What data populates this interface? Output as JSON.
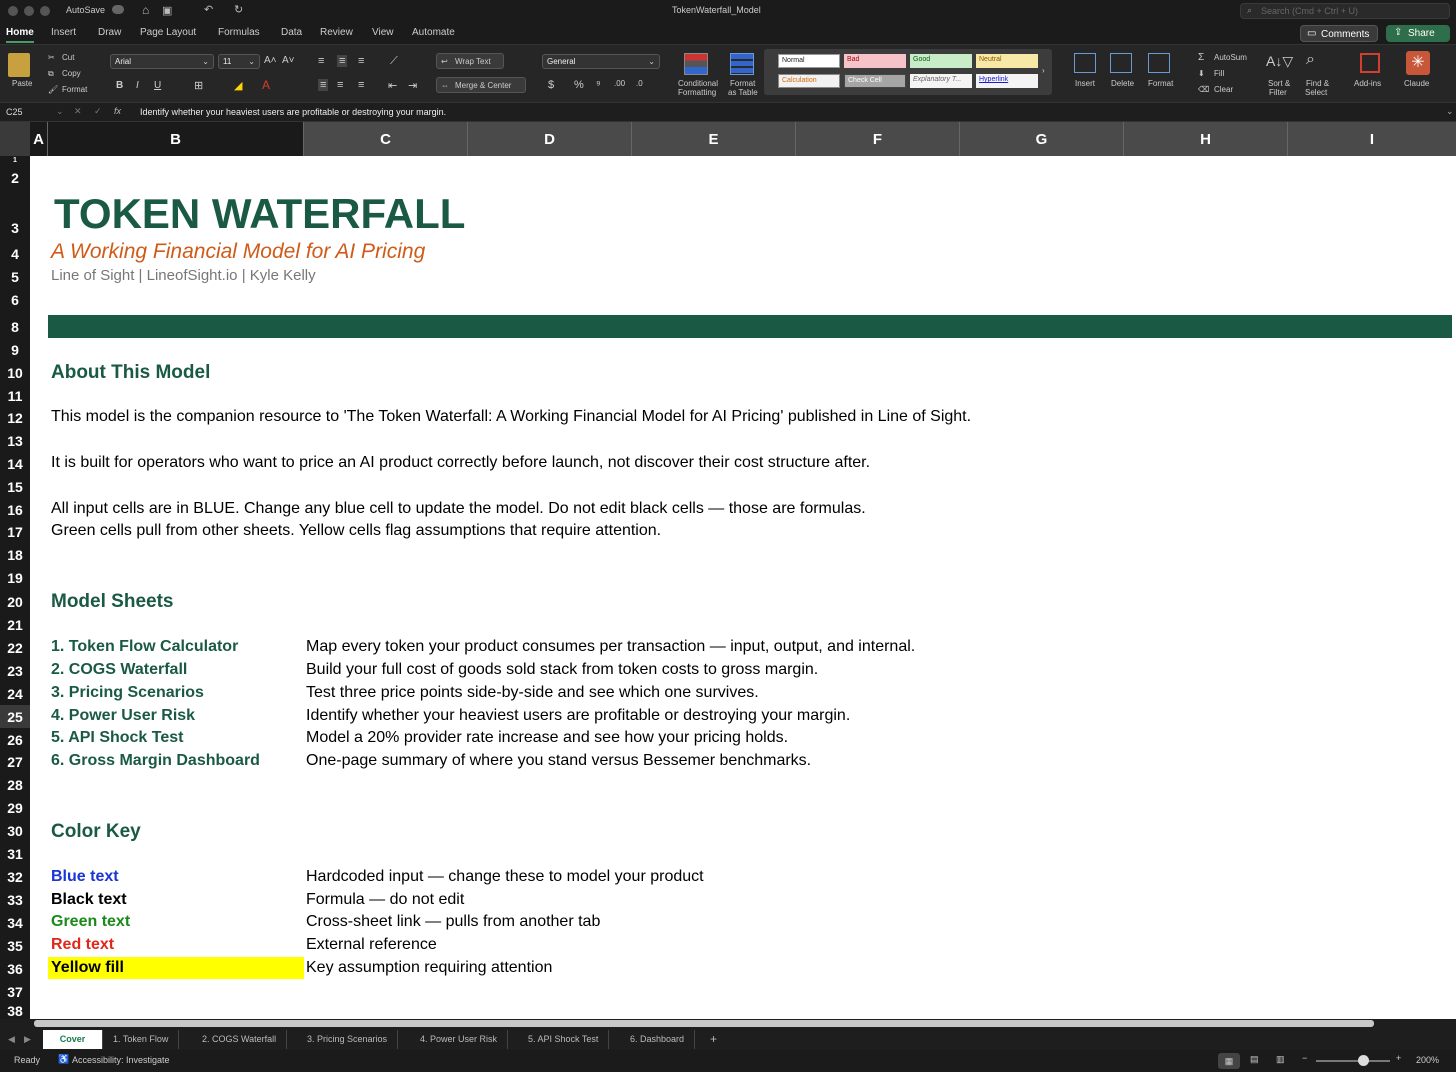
{
  "window": {
    "title": "TokenWaterfall_Model",
    "autosave": "AutoSave",
    "search_placeholder": "Search (Cmd + Ctrl + U)"
  },
  "ribbon_tabs": [
    "Home",
    "Insert",
    "Draw",
    "Page Layout",
    "Formulas",
    "Data",
    "Review",
    "View",
    "Automate"
  ],
  "ribbon_buttons": {
    "comments": "Comments",
    "share": "Share"
  },
  "ribbon": {
    "paste": "Paste",
    "cut": "Cut",
    "copy": "Copy",
    "format": "Format",
    "font": "Arial",
    "size": "11",
    "wrap": "Wrap Text",
    "merge": "Merge & Center",
    "numfmt": "General",
    "cond1": "Conditional",
    "cond2": "Formatting",
    "fat1": "Format",
    "fat2": "as Table",
    "styles": {
      "normal": "Normal",
      "bad": "Bad",
      "good": "Good",
      "neutral": "Neutral",
      "calculation": "Calculation",
      "check": "Check Cell",
      "explanatory": "Explanatory T...",
      "hyperlink": "Hyperlink"
    },
    "insert": "Insert",
    "delete": "Delete",
    "format2": "Format",
    "autosum": "AutoSum",
    "fill": "Fill",
    "clear": "Clear",
    "sort1": "Sort &",
    "sort2": "Filter",
    "find1": "Find &",
    "find2": "Select",
    "addins": "Add-ins",
    "claude": "Claude"
  },
  "formula_bar": {
    "cell_ref": "C25",
    "content": "Identify whether your heaviest users are profitable or destroying your margin."
  },
  "columns": [
    "A",
    "B",
    "C",
    "D",
    "E",
    "F",
    "G",
    "H",
    "I"
  ],
  "rows": [
    "1",
    "2",
    "3",
    "4",
    "5",
    "6",
    "8",
    "9",
    "10",
    "11",
    "12",
    "13",
    "14",
    "15",
    "16",
    "17",
    "18",
    "19",
    "20",
    "21",
    "22",
    "23",
    "24",
    "25",
    "26",
    "27",
    "28",
    "29",
    "30",
    "31",
    "32",
    "33",
    "34",
    "35",
    "36",
    "37",
    "38"
  ],
  "cover": {
    "title": "TOKEN WATERFALL",
    "subtitle": "A Working Financial Model for AI Pricing",
    "byline": "Line of Sight  |  LineofSight.io  |  Kyle Kelly",
    "about_header": "About This Model",
    "about_1": "This model is the companion resource to 'The Token Waterfall: A Working Financial Model for AI Pricing' published in Line of Sight.",
    "about_2": "It is built for operators who want to price an AI product correctly before launch, not discover their cost structure after.",
    "about_3": "All input cells are in BLUE. Change any blue cell to update the model. Do not edit black cells — those are formulas.",
    "about_4": "Green cells pull from other sheets. Yellow cells flag assumptions that require attention.",
    "sheets_header": "Model Sheets",
    "sheets": [
      {
        "name": "1. Token Flow Calculator",
        "desc": "Map every token your product consumes per transaction — input, output, and internal."
      },
      {
        "name": "2. COGS Waterfall",
        "desc": "Build your full cost of goods sold stack from token costs to gross margin."
      },
      {
        "name": "3. Pricing Scenarios",
        "desc": "Test three price points side-by-side and see which one survives."
      },
      {
        "name": "4. Power User Risk",
        "desc": "Identify whether your heaviest users are profitable or destroying your margin."
      },
      {
        "name": "5. API Shock Test",
        "desc": "Model a 20% provider rate increase and see how your pricing holds."
      },
      {
        "name": "6. Gross Margin Dashboard",
        "desc": "One-page summary of where you stand versus Bessemer benchmarks."
      }
    ],
    "key_header": "Color Key",
    "key": [
      {
        "label": "Blue text",
        "desc": "Hardcoded input — change these to model your product",
        "color": "#1a35d6"
      },
      {
        "label": "Black text",
        "desc": "Formula — do not edit",
        "color": "#000000"
      },
      {
        "label": "Green text",
        "desc": "Cross-sheet link — pulls from another tab",
        "color": "#1a8a1a"
      },
      {
        "label": "Red text",
        "desc": "External reference",
        "color": "#e0281a"
      },
      {
        "label": "Yellow fill",
        "desc": "Key assumption requiring attention",
        "color": "#000000"
      }
    ]
  },
  "sheet_tabs": [
    "Cover",
    "1. Token Flow",
    "2. COGS Waterfall",
    "3. Pricing Scenarios",
    "4. Power User Risk",
    "5. API Shock Test",
    "6. Dashboard"
  ],
  "status": {
    "ready": "Ready",
    "accessibility": "Accessibility: Investigate",
    "zoom": "200%"
  },
  "colors": {
    "brand_green": "#1a5a44",
    "subtitle_orange": "#d05a18",
    "yellow_fill": "#ffff00"
  }
}
